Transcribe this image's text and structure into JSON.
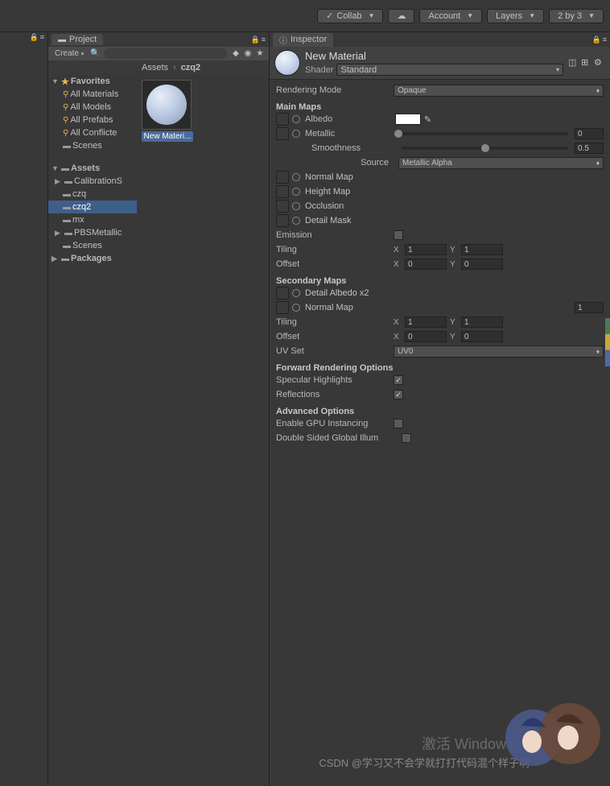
{
  "topbar": {
    "collab": "Collab",
    "account": "Account",
    "layers": "Layers",
    "layout": "2 by 3"
  },
  "project": {
    "tab": "Project",
    "create": "Create",
    "breadcrumb": {
      "root": "Assets",
      "current": "czq2"
    },
    "favorites": {
      "label": "Favorites",
      "items": [
        "All Materials",
        "All Models",
        "All Prefabs",
        "All Conflicte"
      ]
    },
    "scenes": "Scenes",
    "assets": {
      "label": "Assets",
      "items": [
        "CalibrationS",
        "czq",
        "czq2",
        "mx",
        "PBSMetallic",
        "Scenes"
      ]
    },
    "packages": "Packages",
    "asset_thumb": "New Materi..."
  },
  "inspector": {
    "tab": "Inspector",
    "title": "New Material",
    "shader_label": "Shader",
    "shader_value": "Standard",
    "rendering_mode": {
      "label": "Rendering Mode",
      "value": "Opaque"
    },
    "main_maps": "Main Maps",
    "albedo": "Albedo",
    "metallic": "Metallic",
    "metallic_value": "0",
    "smoothness": "Smoothness",
    "smoothness_value": "0.5",
    "source": "Source",
    "source_value": "Metallic Alpha",
    "normal_map": "Normal Map",
    "height_map": "Height Map",
    "occlusion": "Occlusion",
    "detail_mask": "Detail Mask",
    "emission": "Emission",
    "tiling": "Tiling",
    "offset": "Offset",
    "tiling_x": "1",
    "tiling_y": "1",
    "offset_x": "0",
    "offset_y": "0",
    "secondary_maps": "Secondary Maps",
    "detail_albedo": "Detail Albedo x2",
    "normal_map2": "Normal Map",
    "normal_map2_value": "1",
    "tiling2_x": "1",
    "tiling2_y": "1",
    "offset2_x": "0",
    "offset2_y": "0",
    "uv_set": "UV Set",
    "uv_set_value": "UV0",
    "forward": "Forward Rendering Options",
    "specular": "Specular Highlights",
    "reflections": "Reflections",
    "advanced": "Advanced Options",
    "gpu_instancing": "Enable GPU Instancing",
    "double_sided": "Double Sided Global Illum"
  },
  "watermark": {
    "line1": "激活 Windows",
    "line2": "CSDN @学习又不会学就打打代码混个样子啊"
  }
}
